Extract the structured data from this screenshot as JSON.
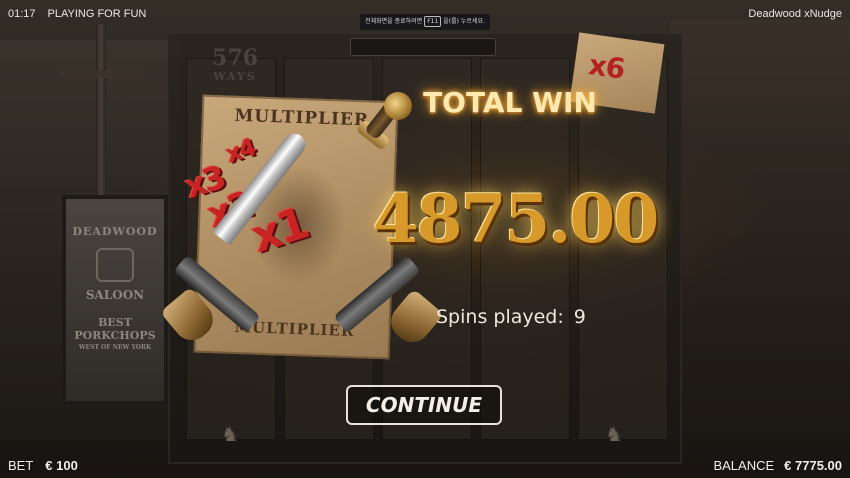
{
  "top_bar": {
    "clock": "01:17",
    "mode": "PLAYING FOR FUN",
    "fullscreen_notice": {
      "text_before": "전체화면을 종료하려면",
      "key": "F11",
      "text_after": "을(를) 누르세요."
    },
    "game_name": "Deadwood xNudge"
  },
  "reels": {
    "ways_number": "576",
    "ways_label": "WAYS",
    "poster_title": "MULTIPLIER",
    "poster_bottom": "MULTIPLIER",
    "side_multiplier": "x6"
  },
  "multipliers": [
    "x4",
    "x3",
    "x2",
    "x1"
  ],
  "saloon_sign": {
    "line1": "DEADWOOD",
    "line2": "SALOON",
    "line3": "BEST PORKCHOPS",
    "line4": "WEST OF NEW YORK"
  },
  "win_panel": {
    "title": "TOTAL WIN",
    "amount": "4875.00",
    "spins_label": "Spins played:",
    "spins_value": "9",
    "continue_label": "CONTINUE"
  },
  "bottom_bar": {
    "bet_label": "BET",
    "bet_value": "€ 100",
    "balance_label": "BALANCE",
    "balance_value": "€ 7775.00"
  },
  "icons": {
    "horse_left": "horse-icon",
    "horse_right": "horse-icon"
  },
  "colors": {
    "glow": "#ffb640",
    "win_gold": "#d79a2a",
    "multiplier_red": "#c92424",
    "poster_paper": "#c9a97c"
  }
}
